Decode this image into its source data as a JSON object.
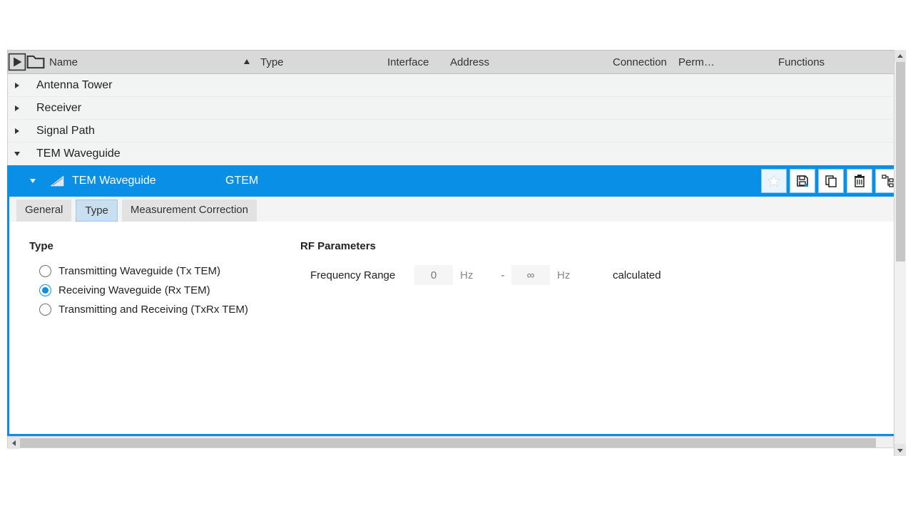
{
  "header": {
    "columns": {
      "name": "Name",
      "type": "Type",
      "interface": "Interface",
      "address": "Address",
      "connection": "Connection",
      "perm": "Perm…",
      "functions": "Functions"
    }
  },
  "tree": {
    "items": [
      {
        "label": "Antenna Tower",
        "expanded": false
      },
      {
        "label": "Receiver",
        "expanded": false
      },
      {
        "label": "Signal Path",
        "expanded": false
      },
      {
        "label": "TEM Waveguide",
        "expanded": true
      }
    ]
  },
  "selected": {
    "name": "TEM Waveguide",
    "type": "GTEM",
    "toolbar_icons": [
      "star-icon",
      "save-icon",
      "copy-icon",
      "delete-icon",
      "tree-icon"
    ]
  },
  "tabs": {
    "items": [
      "General",
      "Type",
      "Measurement Correction"
    ],
    "active_index": 1
  },
  "type_panel": {
    "section_title": "Type",
    "options": [
      "Transmitting Waveguide (Tx TEM)",
      "Receiving Waveguide (Rx TEM)",
      "Transmitting and Receiving (TxRx TEM)"
    ],
    "selected_index": 1
  },
  "rf_panel": {
    "section_title": "RF Parameters",
    "freq_label": "Frequency Range",
    "freq_min_placeholder": "0",
    "freq_max_placeholder": "∞",
    "unit": "Hz",
    "status": "calculated"
  }
}
